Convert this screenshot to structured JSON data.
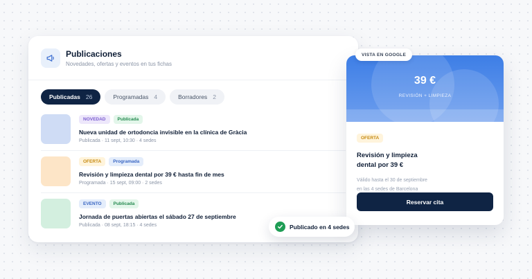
{
  "colors": {
    "navy": "#0f2444",
    "google_blue": "#3d7ee6",
    "success_green": "#1f9d55"
  },
  "panel": {
    "icon": "megaphone-icon",
    "title": "Publicaciones",
    "subtitle": "Novedades, ofertas y eventos en tus fichas"
  },
  "tabs": [
    {
      "label": "Publicadas",
      "count": "26",
      "active": true
    },
    {
      "label": "Programadas",
      "count": "4",
      "active": false
    },
    {
      "label": "Borradores",
      "count": "2",
      "active": false
    }
  ],
  "posts": [
    {
      "type": "NOVEDAD",
      "type_bg": "#ede7fb",
      "type_fg": "#7a5ccf",
      "status": "Publicada",
      "status_bg": "#e3f6ea",
      "status_fg": "#24894f",
      "thumb": "#cfdcf5",
      "title": "Nueva unidad de ortodoncia invisible en la clínica de Gràcia",
      "meta": "Publicada · 11 sept, 10:30 · 4 sedes"
    },
    {
      "type": "OFERTA",
      "type_bg": "#fff4dc",
      "type_fg": "#c68a12",
      "status": "Programada",
      "status_bg": "#e4edfb",
      "status_fg": "#3865c2",
      "thumb": "#fde5c7",
      "title": "Revisión y limpieza dental por 39 € hasta fin de mes",
      "meta": "Programada · 15 sept, 09:00 · 2 sedes"
    },
    {
      "type": "EVENTO",
      "type_bg": "#e4edfb",
      "type_fg": "#3865c2",
      "status": "Publicada",
      "status_bg": "#e3f6ea",
      "status_fg": "#24894f",
      "thumb": "#d3efdf",
      "title": "Jornada de puertas abiertas el sábado 27 de septiembre",
      "meta": "Publicada · 08 sept, 18:15 · 4 sedes"
    }
  ],
  "google_preview": {
    "tag": "VISTA EN GOOGLE",
    "price": "39 €",
    "subtitle": "REVISIÓN + LIMPIEZA",
    "badge": "OFERTA",
    "title_line1": "Revisión y limpieza",
    "title_line2": "dental por 39 €",
    "detail_line1": "Válido hasta el 30 de septiembre",
    "detail_line2": "en las 4 sedes de Barcelona",
    "button": "Reservar cita"
  },
  "toast": {
    "icon": "check-circle-icon",
    "text": "Publicado en 4 sedes"
  }
}
